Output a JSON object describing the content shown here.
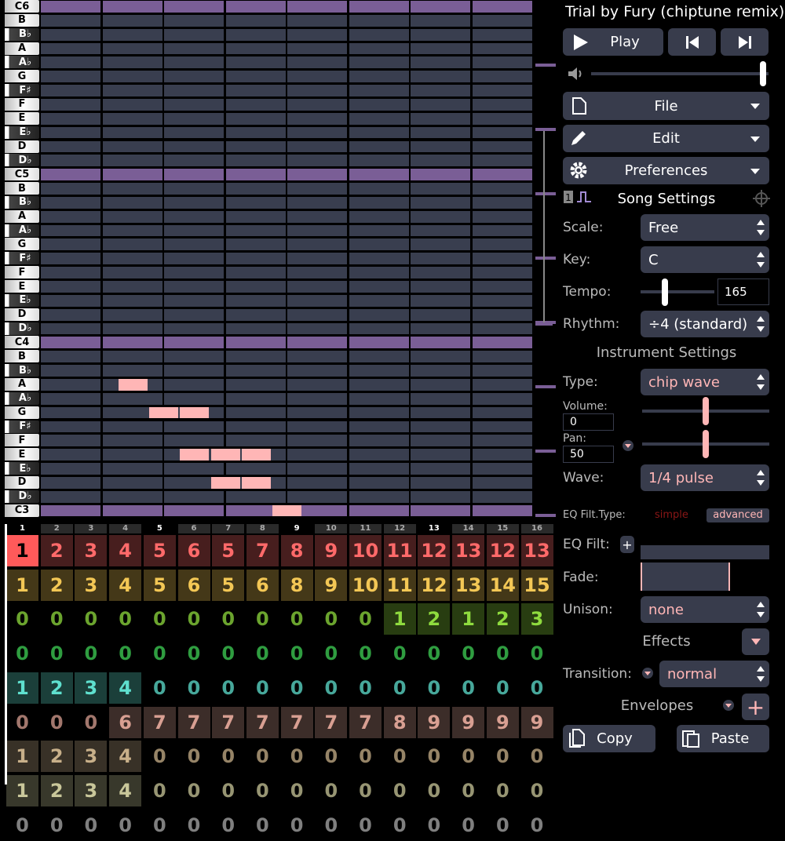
{
  "piano_keys": [
    "C6",
    "B",
    "B♭",
    "A",
    "A♭",
    "G",
    "F♯",
    "F",
    "E",
    "E♭",
    "D",
    "D♭",
    "C5",
    "B",
    "B♭",
    "A",
    "A♭",
    "G",
    "F♯",
    "F",
    "E",
    "E♭",
    "D",
    "D♭",
    "C4",
    "B",
    "B♭",
    "A",
    "A♭",
    "G",
    "F♯",
    "F",
    "E",
    "E♭",
    "D",
    "D♭",
    "C3"
  ],
  "notes": [
    {
      "pitch": "A3",
      "bar": 3,
      "step": 1
    },
    {
      "pitch": "G3",
      "bar": 4,
      "step": 1
    },
    {
      "pitch": "G3",
      "bar": 5,
      "step": 1
    },
    {
      "pitch": "E3",
      "bar": 4,
      "step": 2
    },
    {
      "pitch": "E3",
      "bar": 5,
      "step": 2
    },
    {
      "pitch": "E3",
      "bar": 6,
      "step": 2
    },
    {
      "pitch": "D3",
      "bar": 6,
      "step": 1
    },
    {
      "pitch": "D3",
      "bar": 7,
      "step": 1
    },
    {
      "pitch": "C3",
      "bar": 7,
      "step": 2
    }
  ],
  "bar_numbers": [
    "1",
    "2",
    "3",
    "4",
    "5",
    "6",
    "7",
    "8",
    "9",
    "10",
    "11",
    "12",
    "13",
    "14",
    "15",
    "16"
  ],
  "highlighted_bars": [
    "1",
    "5",
    "9",
    "13"
  ],
  "sequencer": {
    "rows": [
      {
        "values": [
          "1",
          "2",
          "3",
          "4",
          "5",
          "6",
          "5",
          "7",
          "8",
          "9",
          "10",
          "11",
          "12",
          "13",
          "12",
          "13"
        ],
        "color": "#ff6a6a"
      },
      {
        "values": [
          "1",
          "2",
          "3",
          "4",
          "5",
          "6",
          "5",
          "6",
          "8",
          "9",
          "10",
          "11",
          "12",
          "13",
          "14",
          "15"
        ],
        "color": "#f3c755"
      },
      {
        "values": [
          "0",
          "0",
          "0",
          "0",
          "0",
          "0",
          "0",
          "0",
          "0",
          "0",
          "0",
          "1",
          "2",
          "1",
          "2",
          "3"
        ],
        "color": "#8fdb3e"
      },
      {
        "values": [
          "0",
          "0",
          "0",
          "0",
          "0",
          "0",
          "0",
          "0",
          "0",
          "0",
          "0",
          "0",
          "0",
          "0",
          "0",
          "0"
        ],
        "color": "#3fd255"
      },
      {
        "values": [
          "1",
          "2",
          "3",
          "4",
          "0",
          "0",
          "0",
          "0",
          "0",
          "0",
          "0",
          "0",
          "0",
          "0",
          "0",
          "0"
        ],
        "color": "#5fe0cf"
      },
      {
        "values": [
          "0",
          "0",
          "0",
          "6",
          "7",
          "7",
          "7",
          "7",
          "7",
          "7",
          "7",
          "8",
          "9",
          "9",
          "9",
          "9"
        ],
        "color": "#d89f92"
      },
      {
        "values": [
          "1",
          "2",
          "3",
          "4",
          "0",
          "0",
          "0",
          "0",
          "0",
          "0",
          "0",
          "0",
          "0",
          "0",
          "0",
          "0"
        ],
        "color": "#c8b08a"
      },
      {
        "values": [
          "1",
          "2",
          "3",
          "4",
          "0",
          "0",
          "0",
          "0",
          "0",
          "0",
          "0",
          "0",
          "0",
          "0",
          "0",
          "0"
        ],
        "color": "#c9c79a"
      },
      {
        "values": [
          "0",
          "0",
          "0",
          "0",
          "0",
          "0",
          "0",
          "0",
          "0",
          "0",
          "0",
          "0",
          "0",
          "0",
          "0",
          "0"
        ],
        "color": "#aaa"
      }
    ]
  },
  "panel": {
    "title": "Trial by Fury (chiptune remix)",
    "play_label": "Play",
    "volume_level": 0.97,
    "menus": {
      "file": "File",
      "edit": "Edit",
      "preferences": "Preferences"
    },
    "song_settings": {
      "heading": "Song Settings",
      "scale_label": "Scale:",
      "scale_value": "Free",
      "key_label": "Key:",
      "key_value": "C",
      "tempo_label": "Tempo:",
      "tempo_value": "165",
      "tempo_level": 0.33,
      "rhythm_label": "Rhythm:",
      "rhythm_value": "÷4 (standard)"
    },
    "instrument_settings": {
      "heading": "Instrument Settings",
      "type_label": "Type:",
      "type_value": "chip wave",
      "volume_label": "Volume:",
      "volume_value": "0",
      "volume_level": 0.5,
      "pan_label": "Pan:",
      "pan_value": "50",
      "pan_level": 0.5,
      "wave_label": "Wave:",
      "wave_value": "1/4 pulse",
      "eq_type_label": "EQ Filt.Type:",
      "eq_simple": "simple",
      "eq_advanced": "advanced",
      "eq_filt_label": "EQ Filt:",
      "fade_label": "Fade:",
      "unison_label": "Unison:",
      "unison_value": "none",
      "effects_label": "Effects",
      "transition_label": "Transition:",
      "transition_value": "normal",
      "envelopes_label": "Envelopes",
      "copy_label": "Copy",
      "paste_label": "Paste"
    }
  },
  "colors": {
    "note": "#ffb6b6",
    "grid_cell": "#393e4f",
    "octave_row": "#7a5e96",
    "button_bg": "#383c4c",
    "selected_bar": "#ff5a5a"
  }
}
